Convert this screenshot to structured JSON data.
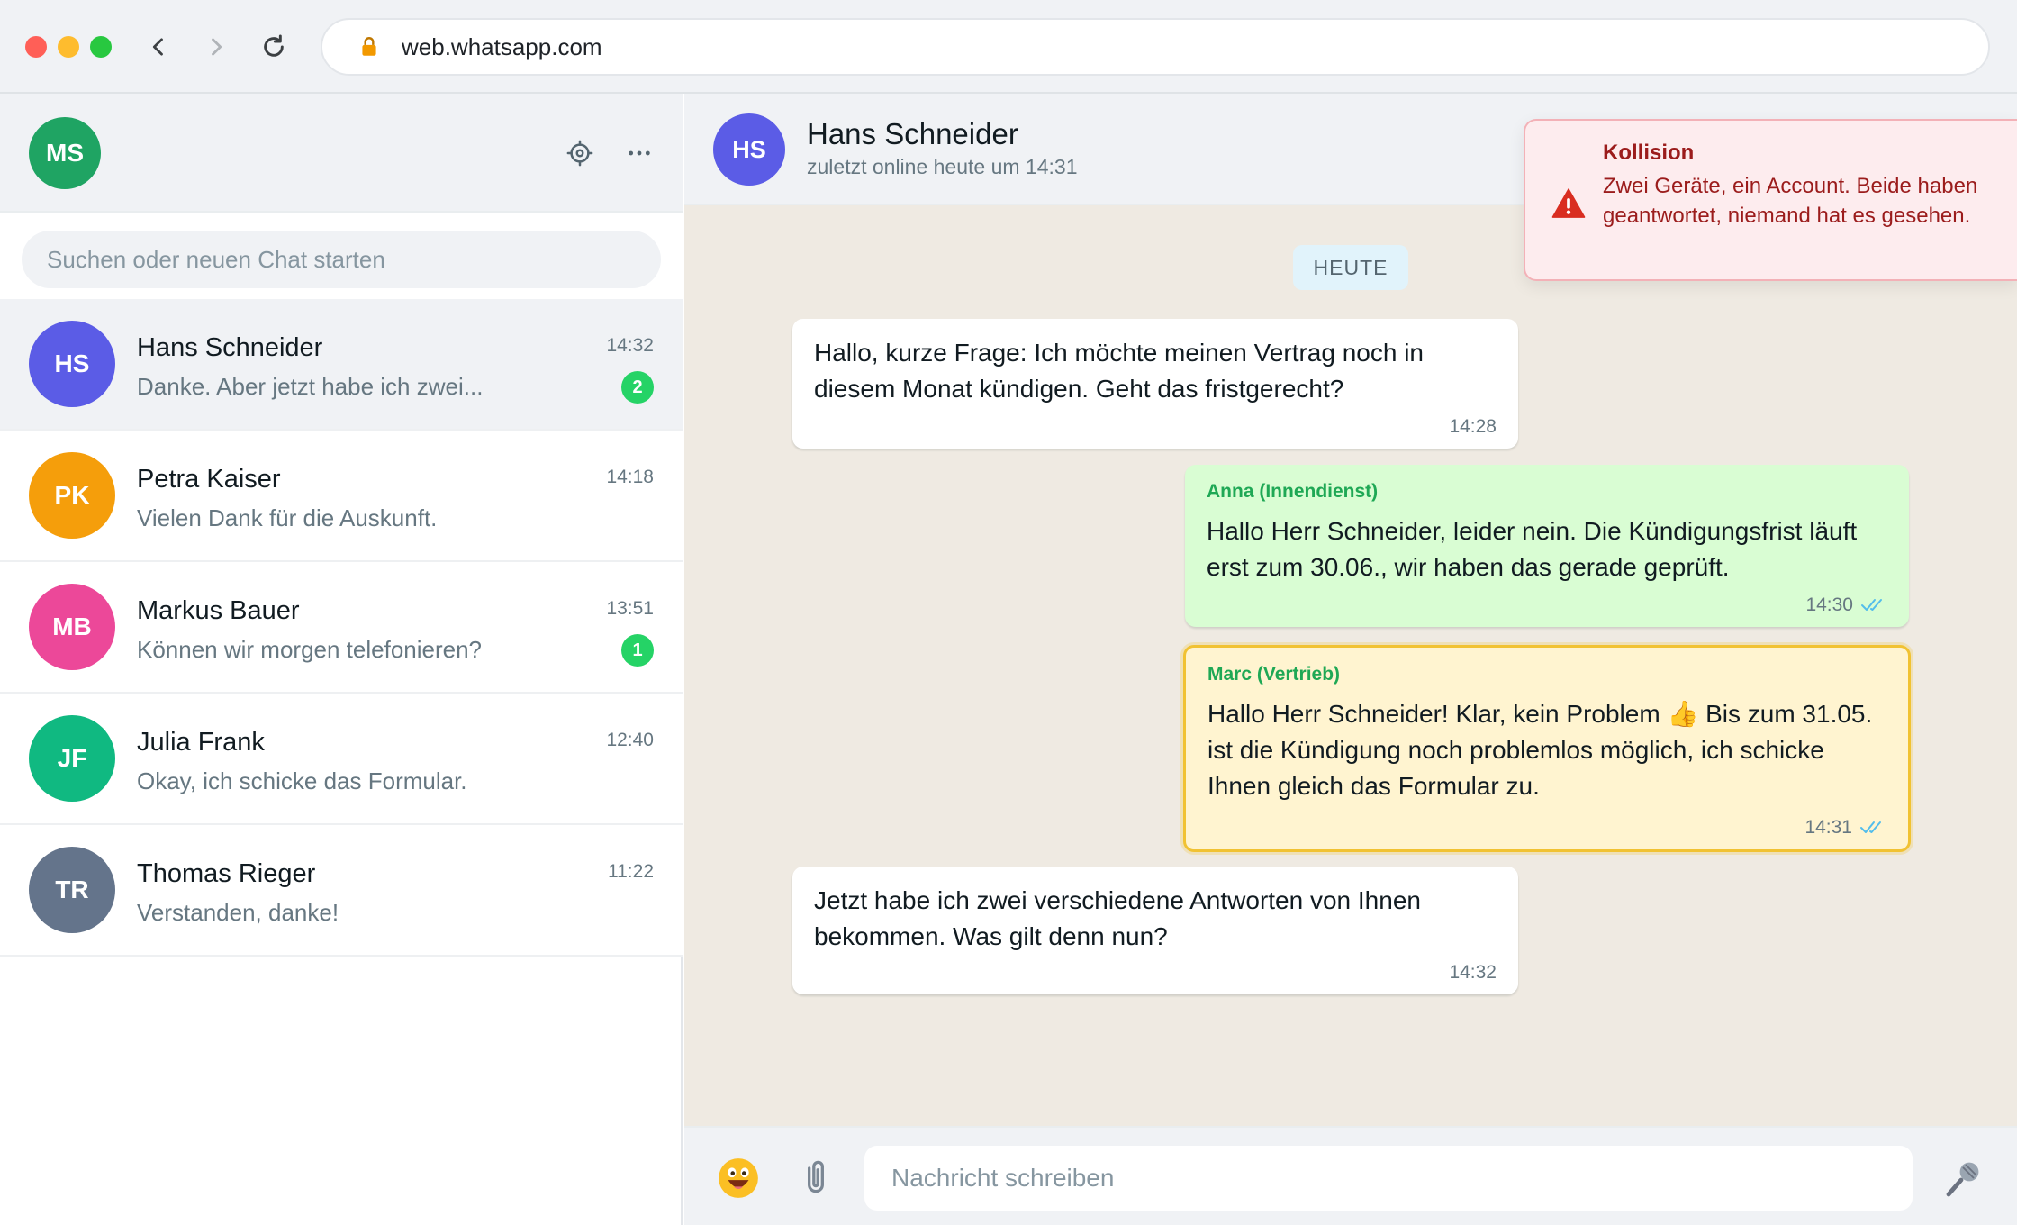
{
  "browser": {
    "url": "web.whatsapp.com"
  },
  "me": {
    "initials": "MS",
    "color": "#1fa463"
  },
  "sidebar": {
    "search_placeholder": "Suchen oder neuen Chat starten",
    "chats": [
      {
        "initials": "HS",
        "color": "#5b5ce6",
        "name": "Hans Schneider",
        "preview": "Danke. Aber jetzt habe ich zwei...",
        "time": "14:32",
        "unread": "2",
        "active": true
      },
      {
        "initials": "PK",
        "color": "#f59e0b",
        "name": "Petra Kaiser",
        "preview": "Vielen Dank für die Auskunft.",
        "time": "14:18",
        "unread": "",
        "active": false
      },
      {
        "initials": "MB",
        "color": "#ec4899",
        "name": "Markus Bauer",
        "preview": "Können wir morgen telefonieren?",
        "time": "13:51",
        "unread": "1",
        "active": false
      },
      {
        "initials": "JF",
        "color": "#10b981",
        "name": "Julia Frank",
        "preview": "Okay, ich schicke das Formular.",
        "time": "12:40",
        "unread": "",
        "active": false
      },
      {
        "initials": "TR",
        "color": "#64748b",
        "name": "Thomas Rieger",
        "preview": "Verstanden, danke!",
        "time": "11:22",
        "unread": "",
        "active": false
      }
    ]
  },
  "conversation": {
    "contact": {
      "initials": "HS",
      "color": "#5b5ce6",
      "name": "Hans Schneider",
      "status": "zuletzt online heute um 14:31"
    },
    "day_label": "HEUTE",
    "messages": [
      {
        "direction": "in",
        "sender": "",
        "text": "Hallo, kurze Frage: Ich möchte meinen Vertrag noch in diesem Monat kündigen. Geht das fristgerecht?",
        "time": "14:28"
      },
      {
        "direction": "out",
        "sender": "Anna (Innendienst)",
        "text": "Hallo Herr Schneider, leider nein. Die Kündigungsfrist läuft erst zum 30.06., wir haben das gerade geprüft.",
        "time": "14:30",
        "read": true
      },
      {
        "direction": "out",
        "sender": "Marc (Vertrieb)",
        "text": "Hallo Herr Schneider! Klar, kein Problem 👍 Bis zum 31.05. ist die Kündigung noch problemlos möglich, ich schicke Ihnen gleich das Formular zu.",
        "time": "14:31",
        "read": true,
        "highlighted": true
      },
      {
        "direction": "in",
        "sender": "",
        "text": "Jetzt habe ich zwei verschiedene Antworten von Ihnen bekommen. Was gilt denn nun?",
        "time": "14:32"
      }
    ],
    "composer_placeholder": "Nachricht schreiben"
  },
  "alert": {
    "title": "Kollision",
    "body": "Zwei Geräte, ein Account. Beide haben geantwortet, niemand hat es gesehen.",
    "color": "#9b1c1c"
  },
  "icons": {
    "back": "chevron-left-icon",
    "forward": "chevron-right-icon",
    "reload": "reload-icon",
    "lock": "lock-icon",
    "settings": "gear-icon",
    "more": "more-icon",
    "emoji": "emoji-icon",
    "attach": "paperclip-icon",
    "mic": "microphone-icon",
    "warning": "warning-icon",
    "read": "double-check-icon"
  }
}
